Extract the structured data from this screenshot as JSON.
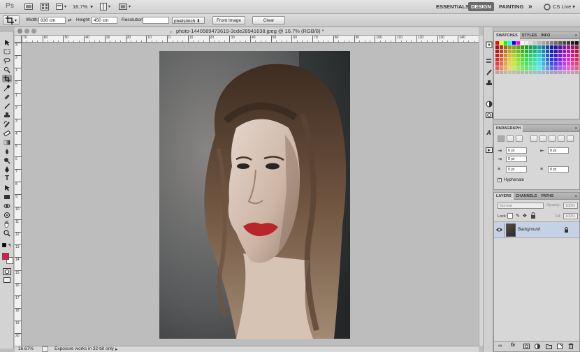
{
  "app": {
    "logo": "Ps",
    "zoom": "16.7%",
    "workspaces": [
      "ESSENTIALS",
      "DESIGN",
      "PAINTING"
    ],
    "active_workspace": "DESIGN",
    "more": "»",
    "cslive": "CS Live",
    "more_caret": "▾"
  },
  "options": {
    "width_label": "Width:",
    "width_value": "830 cm",
    "height_label": "Height:",
    "height_value": "450 cm",
    "resolution_label": "Resolution:",
    "resolution_value": "",
    "resolution_unit": "pixels/inch",
    "front_image": "Front Image",
    "clear": "Clear"
  },
  "document": {
    "title": "photo-1440589473619-3cde28941638.jpeg @ 16.7% (RGB/8) *",
    "ruler_h": [
      "70",
      "60",
      "50",
      "40",
      "30",
      "20",
      "10",
      "0",
      "10",
      "20",
      "30",
      "40",
      "50",
      "60",
      "70",
      "80",
      "90",
      "100",
      "110",
      "120",
      "130",
      "140"
    ],
    "ruler_v": [
      "3",
      "2",
      "1",
      "0",
      "1",
      "2",
      "3",
      "4",
      "5",
      "6",
      "7",
      "8",
      "9",
      "10",
      "11",
      "12",
      "13",
      "14",
      "15",
      "16",
      "17",
      "18",
      "19",
      "20"
    ],
    "zoom_status": "16.67%",
    "status_text": "Exposure works in 32-bit only"
  },
  "colors": {
    "foreground": "#e8154a",
    "background": "#ffffff",
    "layer_selected": "#c5d1e4",
    "photo_lip": "#b8262c"
  },
  "panels": {
    "swatches_tabs": [
      "SWATCHES",
      "STYLES",
      "INFO"
    ],
    "paragraph_tab": "PARAGRAPH",
    "paragraph_fields": [
      "0 pt",
      "0 pt",
      "0 pt",
      "0 pt",
      "0 pt"
    ],
    "hyphenate": "Hyphenate",
    "layers_tabs": [
      "LAYERS",
      "CHANNELS",
      "PATHS"
    ],
    "blend_mode": "Normal",
    "opacity_label": "Opacity:",
    "opacity_value": "100%",
    "lock_label": "Lock:",
    "fill_label": "Fill:",
    "fill_value": "100%",
    "layer_name": "Background"
  },
  "icons": [
    "crop-tool-icon",
    "move-tool-icon",
    "marquee-tool-icon",
    "lasso-tool-icon",
    "quick-select-icon",
    "eyedropper-icon",
    "heal-icon",
    "brush-icon",
    "stamp-icon",
    "history-brush-icon",
    "eraser-icon",
    "gradient-icon",
    "blur-icon",
    "dodge-icon",
    "pen-icon",
    "type-icon",
    "path-select-icon",
    "shape-icon",
    "3d-rotate-icon",
    "hand-icon",
    "zoom-icon",
    "quick-mask-icon",
    "screen-mode-icon",
    "eye-icon",
    "lock-icon",
    "link-icon",
    "fx-icon",
    "mask-icon",
    "adjustment-icon",
    "folder-icon",
    "new-layer-icon",
    "trash-icon"
  ]
}
